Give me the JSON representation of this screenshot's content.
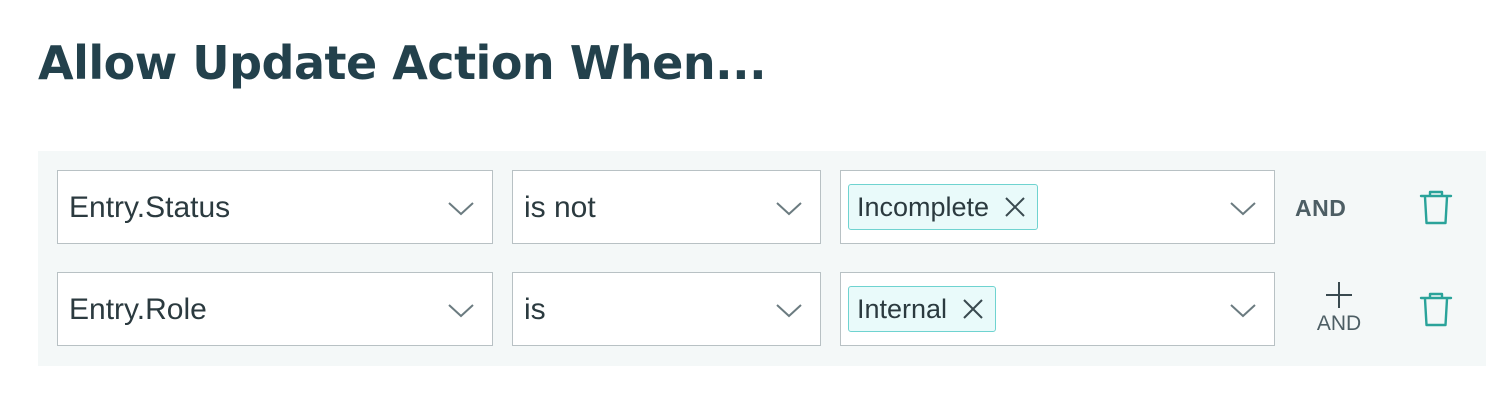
{
  "title": "Allow Update Action When...",
  "conditions": [
    {
      "field": "Entry.Status",
      "operator": "is not",
      "values": [
        "Incomplete"
      ],
      "connector": "AND"
    },
    {
      "field": "Entry.Role",
      "operator": "is",
      "values": [
        "Internal"
      ],
      "add_connector_label": "AND"
    }
  ],
  "colors": {
    "title": "#23414c",
    "accent": "#2aa39a",
    "chip_border": "#6fd3d0",
    "chip_bg": "#e9fafa",
    "panel_bg": "#f4f8f8"
  },
  "icons": {
    "dropdown": "chevron-down-icon",
    "remove_value": "close-icon",
    "delete_row": "trash-icon",
    "add": "plus-icon"
  }
}
